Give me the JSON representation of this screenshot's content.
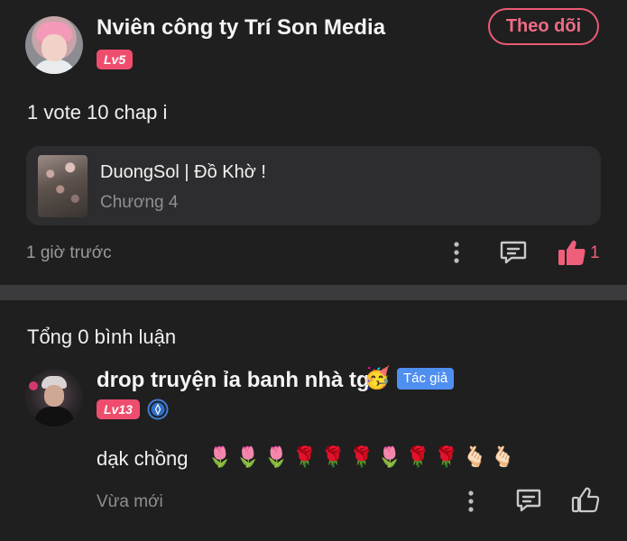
{
  "post": {
    "author_name": "Nviên công ty Trí Son Media",
    "author_level": "Lv5",
    "follow_label": "Theo dõi",
    "text": "1 vote 10 chap i",
    "story": {
      "title": "DuongSol | Đồ Khờ !",
      "chapter": "Chương 4"
    },
    "time": "1 giờ trước",
    "like_count": "1",
    "accent_color": "#ef4d6d"
  },
  "comments_section": {
    "count_label": "Tổng 0 bình luận",
    "comments": [
      {
        "author_name": "drop truyện ỉa banh nhà tg",
        "author_emoji": "🥳",
        "author_badge": "Tác giả",
        "author_level": "Lv13",
        "text": "dạk chồng",
        "emojis": "🌷🌷🌷🌹🌹🌹🌷🌹🌹🫰🏻🫰🏻",
        "time": "Vừa mới"
      }
    ]
  },
  "icons": {
    "more": "more-vertical-icon",
    "comment": "comment-icon",
    "like": "thumbs-up-icon",
    "verified": "crown-badge-icon"
  }
}
